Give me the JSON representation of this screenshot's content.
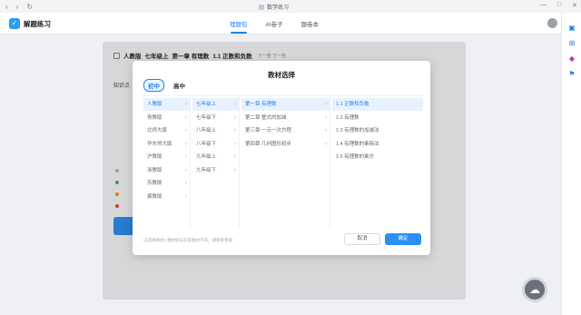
{
  "browser": {
    "title": "数学练习",
    "nav_back": "‹",
    "nav_forward": "›",
    "nav_refresh": "↻",
    "win_min": "—",
    "win_max": "□",
    "win_close": "✕"
  },
  "app": {
    "logo_mark": "✓",
    "name": "解题练习",
    "tabs": [
      {
        "label": "理题包",
        "active": true
      },
      {
        "label": "AI卷子",
        "active": false
      },
      {
        "label": "题卷本",
        "active": false
      }
    ]
  },
  "right_rail": {
    "icons": [
      {
        "name": "image-icon",
        "glyph": "▣",
        "color": "#1e82f0"
      },
      {
        "name": "scan-icon",
        "glyph": "⊞",
        "color": "#1e82f0"
      },
      {
        "name": "gem-icon",
        "glyph": "◆",
        "color": "#c0399b"
      },
      {
        "name": "bookmark-icon",
        "glyph": "⚑",
        "color": "#1e82f0"
      }
    ]
  },
  "page": {
    "breadcrumb": [
      "人教版",
      "七年级上",
      "第一章 有理数",
      "1.1 正数和负数"
    ],
    "breadcrumb_sub": "下一卷  下一卷",
    "left_label": "知识点",
    "legend_colors": [
      "#bbbbbb",
      "#4caf50",
      "#ff9800",
      "#f44336"
    ]
  },
  "modal": {
    "title": "教材选择",
    "stage_tabs": [
      {
        "label": "初中",
        "active": true
      },
      {
        "label": "高中",
        "active": false
      }
    ],
    "publishers": [
      {
        "label": "人教版",
        "selected": true
      },
      {
        "label": "青教版",
        "selected": false
      },
      {
        "label": "北师大版",
        "selected": false
      },
      {
        "label": "华东师大版",
        "selected": false
      },
      {
        "label": "沪教版",
        "selected": false
      },
      {
        "label": "浙教版",
        "selected": false
      },
      {
        "label": "苏教版",
        "selected": false
      },
      {
        "label": "冀教版",
        "selected": false
      }
    ],
    "grades": [
      {
        "label": "七年级上",
        "selected": true
      },
      {
        "label": "七年级下",
        "selected": false
      },
      {
        "label": "八年级上",
        "selected": false
      },
      {
        "label": "八年级下",
        "selected": false
      },
      {
        "label": "九年级上",
        "selected": false
      },
      {
        "label": "九年级下",
        "selected": false
      }
    ],
    "chapters": [
      {
        "label": "第一章 有理数",
        "selected": true
      },
      {
        "label": "第二章 整式的加减",
        "selected": false
      },
      {
        "label": "第三章 一元一次方程",
        "selected": false
      },
      {
        "label": "第四章 几何图形初步",
        "selected": false
      }
    ],
    "sections": [
      {
        "label": "1.1 正数和负数",
        "selected": true
      },
      {
        "label": "1.2 有理数",
        "selected": false
      },
      {
        "label": "1.3 有理数的加减法",
        "selected": false
      },
      {
        "label": "1.4 有理数的乘除法",
        "selected": false
      },
      {
        "label": "1.5 有理数的乘方",
        "selected": false
      }
    ],
    "chevron": "›",
    "footer_note": "已选择教材 | 教材如与实际教材不符，请联系客服",
    "cancel": "取消",
    "confirm": "确定"
  },
  "float_button": "☁"
}
